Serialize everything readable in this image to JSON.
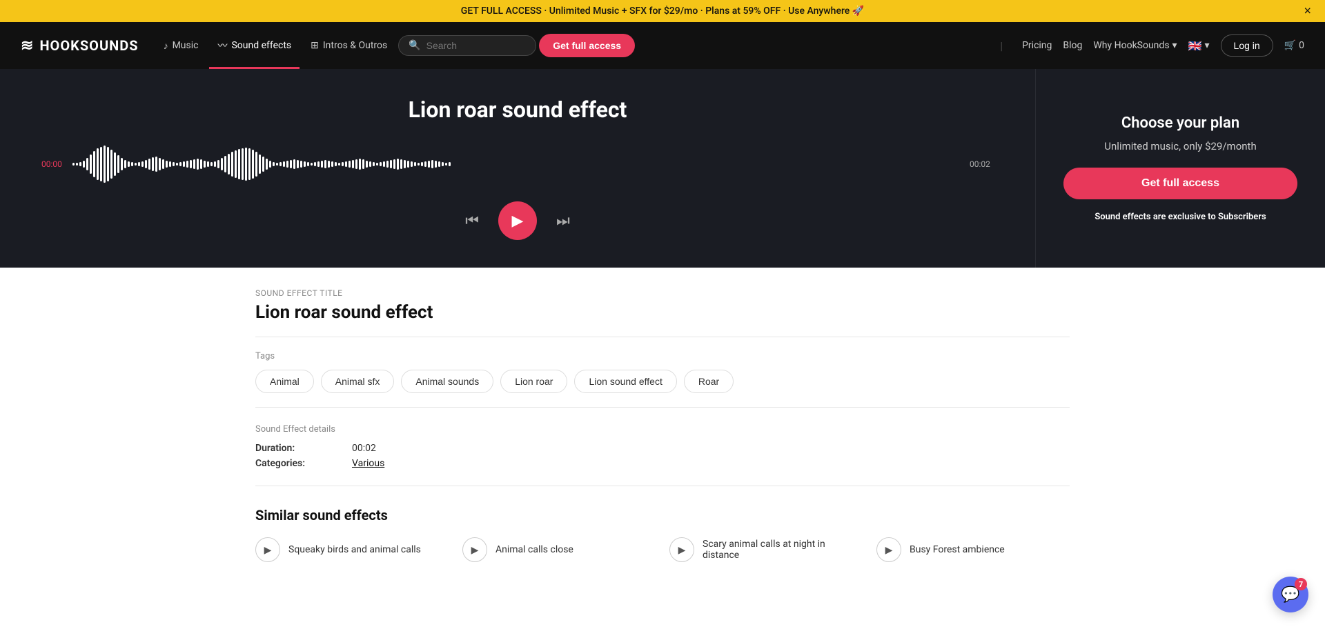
{
  "banner": {
    "text": "GET FULL ACCESS · Unlimited Music + SFX for $29/mo · Plans at 59% OFF · Use Anywhere 🚀",
    "close_label": "×"
  },
  "navbar": {
    "logo": "HOOKSOUNDS",
    "music_label": "Music",
    "sfx_label": "Sound effects",
    "intros_label": "Intros & Outros",
    "search_placeholder": "Search",
    "get_full_access_label": "Get full access",
    "pricing_label": "Pricing",
    "blog_label": "Blog",
    "why_label": "Why HookSounds",
    "login_label": "Log in",
    "cart_label": "0"
  },
  "hero": {
    "title": "Lion roar sound effect",
    "time_start": "00:00",
    "time_end": "00:02"
  },
  "plan": {
    "title": "Choose your plan",
    "subtitle": "Unlimited music, only $29/month",
    "btn_label": "Get full access",
    "note": "Sound effects are exclusive to Subscribers"
  },
  "details_section": {
    "title_label": "Sound Effect title",
    "title": "Lion roar sound effect",
    "tags_label": "Tags",
    "tags": [
      "Animal",
      "Animal sfx",
      "Animal sounds",
      "Lion roar",
      "Lion sound effect",
      "Roar"
    ],
    "details_label": "Sound Effect details",
    "duration_label": "Duration:",
    "duration_value": "00:02",
    "categories_label": "Categories:",
    "categories_value": "Various"
  },
  "similar": {
    "title": "Similar sound effects",
    "items": [
      {
        "name": "Squeaky birds and animal calls"
      },
      {
        "name": "Animal calls close"
      },
      {
        "name": "Scary animal calls at night in distance"
      },
      {
        "name": "Busy Forest ambience"
      }
    ]
  },
  "chat": {
    "count": "7"
  },
  "waveform": {
    "bars": [
      2,
      4,
      6,
      10,
      18,
      28,
      38,
      46,
      50,
      54,
      50,
      42,
      34,
      26,
      18,
      12,
      8,
      6,
      4,
      6,
      8,
      12,
      16,
      20,
      22,
      18,
      14,
      10,
      8,
      6,
      4,
      6,
      8,
      10,
      12,
      14,
      16,
      14,
      10,
      8,
      6,
      8,
      12,
      18,
      24,
      30,
      36,
      40,
      44,
      46,
      48,
      46,
      42,
      36,
      28,
      22,
      16,
      10,
      6,
      4,
      6,
      8,
      10,
      12,
      14,
      12,
      10,
      8,
      6,
      4,
      6,
      8,
      10,
      12,
      10,
      8,
      6,
      4,
      6,
      8,
      10,
      12,
      14,
      16,
      14,
      10,
      8,
      6,
      4,
      6,
      8,
      10,
      12,
      14,
      16,
      14,
      12,
      10,
      8,
      6,
      4,
      6,
      8,
      10,
      12,
      10,
      8,
      6,
      4,
      6
    ]
  }
}
